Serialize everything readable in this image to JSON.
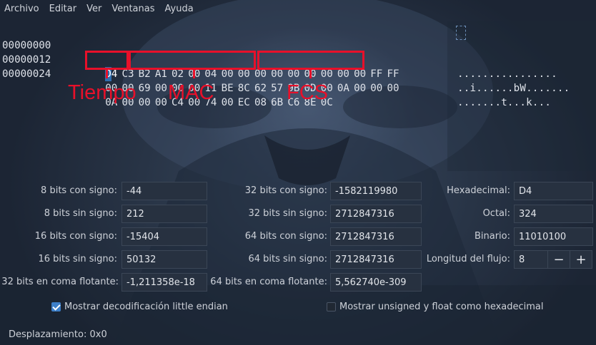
{
  "menu": [
    "Archivo",
    "Editar",
    "Ver",
    "Ventanas",
    "Ayuda"
  ],
  "hex": {
    "rows": [
      {
        "offset": "00000000",
        "bytes": [
          "D4",
          "C3",
          "B2",
          "A1",
          "02",
          "00",
          "04",
          "00",
          "00",
          "00",
          "00",
          "00",
          "00",
          "00",
          "00",
          "00",
          "FF",
          "FF"
        ],
        "ascii": "................"
      },
      {
        "offset": "00000012",
        "bytes": [
          "00",
          "00",
          "69",
          "00",
          "00",
          "00",
          "11",
          "BE",
          "8C",
          "62",
          "57",
          "9B",
          "0D",
          "00",
          "0A",
          "00",
          "00",
          "00"
        ],
        "ascii": "..i......bW......."
      },
      {
        "offset": "00000024",
        "bytes": [
          "0A",
          "00",
          "00",
          "00",
          "C4",
          "00",
          "74",
          "00",
          "EC",
          "08",
          "6B",
          "C6",
          "8E",
          "0C"
        ],
        "ascii": ".......t...k..."
      }
    ],
    "selected_byte": "D4"
  },
  "annotations": [
    {
      "label": "Tiempo"
    },
    {
      "label": "MAC"
    },
    {
      "label": "FCS"
    }
  ],
  "inspector": {
    "col1": [
      {
        "label": "8 bits con signo:",
        "value": "-44"
      },
      {
        "label": "8 bits sin signo:",
        "value": "212"
      },
      {
        "label": "16 bits con signo:",
        "value": "-15404"
      },
      {
        "label": "16 bits sin signo:",
        "value": "50132"
      },
      {
        "label": "32 bits en coma flotante:",
        "value": "-1,211358e-18"
      }
    ],
    "col2": [
      {
        "label": "32 bits con signo:",
        "value": "-1582119980"
      },
      {
        "label": "32 bits sin signo:",
        "value": "2712847316"
      },
      {
        "label": "64 bits con signo:",
        "value": "2712847316"
      },
      {
        "label": "64 bits sin signo:",
        "value": "2712847316"
      },
      {
        "label": "64 bits en coma flotante:",
        "value": "5,562740e-309"
      }
    ],
    "col3": [
      {
        "label": "Hexadecimal:",
        "value": "D4"
      },
      {
        "label": "Octal:",
        "value": "324"
      },
      {
        "label": "Binario:",
        "value": "11010100"
      },
      {
        "label": "Longitud del flujo:",
        "value": "8"
      }
    ],
    "stepper": {
      "minus": "−",
      "plus": "+"
    }
  },
  "options": {
    "little_endian": {
      "label": "Mostrar decodificación little endian",
      "checked": true
    },
    "unsigned_hex": {
      "label": "Mostrar unsigned y float como hexadecimal",
      "checked": false
    }
  },
  "status": "Desplazamiento: 0x0",
  "colors": {
    "annotation": "#e8102a",
    "selection": "#2f6fb0",
    "checkbox": "#3d7fc8"
  }
}
